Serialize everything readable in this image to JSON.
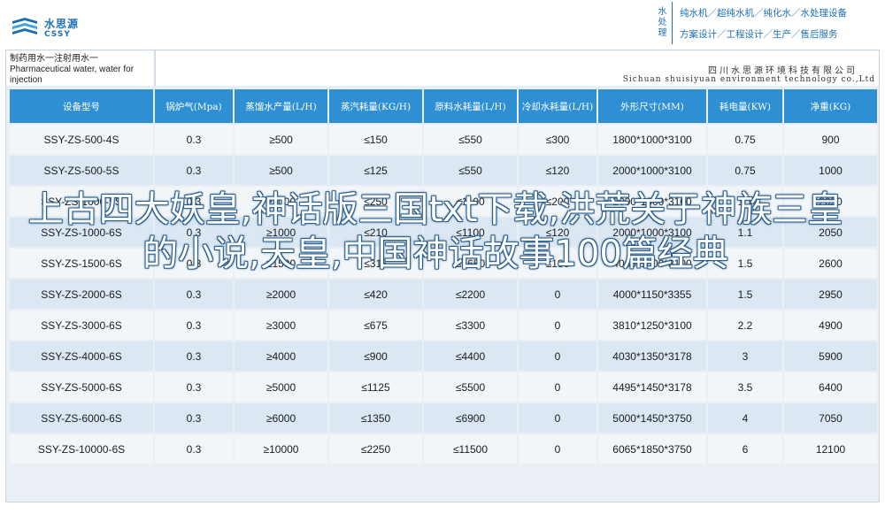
{
  "brand": {
    "name_cn": "水思源",
    "name_en": "CSSY"
  },
  "services": {
    "vertical": [
      "水",
      "处",
      "理"
    ],
    "line1": "纯水机／超纯水机／纯化水／水处理设备",
    "line2": "方案设计／工程设计／生产／售后服务"
  },
  "caption": {
    "left_cn": "制药用水一注射用水一",
    "left_en_1": "Pharmaceutical water, water for",
    "left_en_2": "injection",
    "company_cn": "四川水思源环境科技有限公司",
    "company_en": "Sichuan shuisiyuan environment technology co.,Ltd"
  },
  "table": {
    "headers": [
      "设备型号",
      "锅炉气(Mpa)",
      "蒸馏水产量(L/H)",
      "蒸汽耗量(KG/H)",
      "原料水耗量(L/H)",
      "冷却水耗量(L/H)",
      "外形尺寸(MM)",
      "耗电量(KW)",
      "净重(KG)"
    ],
    "rows": [
      [
        "SSY-ZS-500-4S",
        "0.3",
        "≥500",
        "≤150",
        "≤550",
        "≤300",
        "1800*1000*3100",
        "0.75",
        "900"
      ],
      [
        "SSY-ZS-500-5S",
        "0.3",
        "≥500",
        "≤125",
        "≤550",
        "≤120",
        "2000*1000*3100",
        "0.75",
        "1000"
      ],
      [
        "SSY-ZS-1000-5S",
        "0.3",
        "≥1000",
        "≤250",
        "≤1100",
        "≤200",
        "2000*1000*3100",
        "1.1",
        "2050"
      ],
      [
        "SSY-ZS-1000-6S",
        "0.3",
        "≥1000",
        "≤210",
        "≤1100",
        "≤120",
        "2000*1000*3100",
        "1.1",
        "2050"
      ],
      [
        "SSY-ZS-1500-6S",
        "0.3",
        "≥1500",
        "≤315",
        "≤1650",
        "≤180",
        "4000*1000*3100",
        "1.5",
        "2600"
      ],
      [
        "SSY-ZS-2000-6S",
        "0.3",
        "≥2000",
        "≤420",
        "≤2200",
        "0",
        "4000*1150*3355",
        "1.5",
        "2950"
      ],
      [
        "SSY-ZS-3000-6S",
        "0.3",
        "≥3000",
        "≤675",
        "≤3300",
        "0",
        "3810*1250*3100",
        "2.2",
        "4900"
      ],
      [
        "SSY-ZS-4000-6S",
        "0.3",
        "≥4000",
        "≤900",
        "≤4400",
        "0",
        "4030*1350*3178",
        "3",
        "5900"
      ],
      [
        "SSY-ZS-5000-6S",
        "0.3",
        "≥5000",
        "≤1125",
        "≤5500",
        "0",
        "4495*1450*3178",
        "3.5",
        "6400"
      ],
      [
        "SSY-ZS-6000-6S",
        "0.3",
        "≥6000",
        "≤1350",
        "≤6900",
        "0",
        "5000*1450*3750",
        "4",
        "7050"
      ],
      [
        "SSY-ZS-10000-6S",
        "0.3",
        "≥10000",
        "≤2250",
        "≤11500",
        "0",
        "6065*1850*3750",
        "6",
        "12100"
      ]
    ]
  },
  "overlay_title": "上古四大妖皇,神话版三国txt下载,洪荒关于神族三皇的小说,天皇,中国神话故事100篇经典",
  "colors": {
    "header_blue": "#2f8fd3",
    "brand_blue": "#1d6fb5",
    "row_light": "#f3f6f9",
    "row_dark": "#dbe7f2"
  }
}
